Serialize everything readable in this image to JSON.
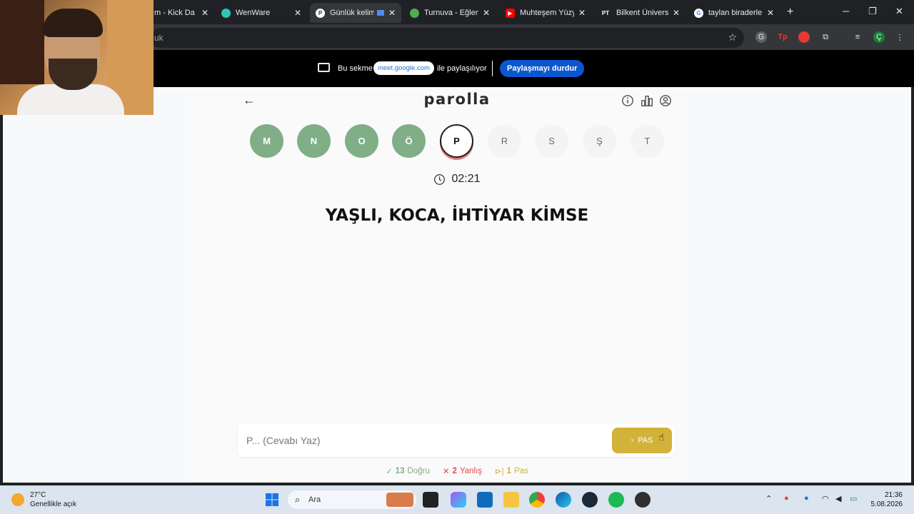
{
  "browser": {
    "tabs": [
      {
        "title": "m - Kick Da",
        "icon": "kick-icon",
        "color": "#53fc18"
      },
      {
        "title": "WenWare",
        "icon": "globe-icon",
        "color": "#2ec4b6"
      },
      {
        "title": "Günlük kelim",
        "icon": "parolla-icon",
        "color": "#ffffff",
        "active": true
      },
      {
        "title": "Turnuva - Eğlenc",
        "icon": "tournament-icon",
        "color": "#4caf50"
      },
      {
        "title": "Muhteşem Yüzy",
        "icon": "youtube-icon",
        "color": "#ff0000"
      },
      {
        "title": "Bilkent Üniversit",
        "icon": "bilkent-icon",
        "color": "#ffffff"
      },
      {
        "title": "taylan biraderler",
        "icon": "google-icon",
        "color": "#4285f4"
      }
    ],
    "url_fragment": "uk"
  },
  "sharebar": {
    "text_before": "Bu sekme",
    "domain": "meet.google.com",
    "text_after": "ile paylaşılıyor",
    "stop_button": "Paylaşmayı durdur"
  },
  "game": {
    "logo": "parolla",
    "letters": [
      {
        "letter": "M",
        "state": "done"
      },
      {
        "letter": "N",
        "state": "done"
      },
      {
        "letter": "O",
        "state": "done"
      },
      {
        "letter": "Ö",
        "state": "done"
      },
      {
        "letter": "P",
        "state": "current"
      },
      {
        "letter": "R",
        "state": "todo"
      },
      {
        "letter": "S",
        "state": "todo"
      },
      {
        "letter": "Ş",
        "state": "todo"
      },
      {
        "letter": "T",
        "state": "todo"
      }
    ],
    "timer": "02:21",
    "question": "YAŞLI, KOCA, İHTİYAR KİMSE",
    "answer_placeholder": "P... (Cevabı Yaz)",
    "pass_button": "PAS",
    "stats": {
      "correct_count": "13",
      "correct_label": "Doğru",
      "wrong_count": "2",
      "wrong_label": "Yanlış",
      "pass_count": "1",
      "pass_label": "Pas"
    },
    "colors": {
      "done": "#7fae87",
      "pass": "#d3b23a",
      "wrong": "#e04848"
    }
  },
  "taskbar": {
    "temperature": "27°C",
    "weather": "Genellikle açık",
    "search_placeholder": "Ara",
    "time": "21:36",
    "date": "5.08.2026"
  }
}
